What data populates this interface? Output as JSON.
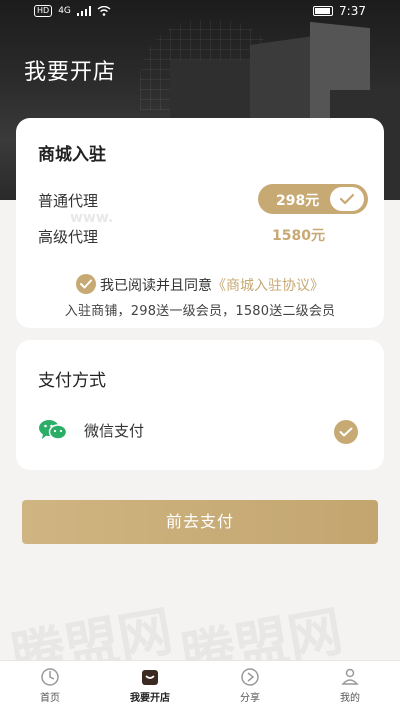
{
  "status_bar": {
    "hd": "HD",
    "signal": "4G",
    "time": "7:37"
  },
  "header": {
    "title": "我要开店"
  },
  "store_card": {
    "title": "商城入驻",
    "options": [
      {
        "label": "普通代理",
        "price": "298元",
        "selected": true
      },
      {
        "label": "高级代理",
        "price": "1580元",
        "selected": false
      }
    ],
    "agreement_prefix": "我已阅读并且同意",
    "agreement_link": "《商城入驻协议》",
    "note": "入驻商铺，298送一级会员，1580送二级会员"
  },
  "payment_card": {
    "title": "支付方式",
    "method_label": "微信支付",
    "method_icon": "wechat-icon",
    "selected": true
  },
  "pay_button": {
    "label": "前去支付"
  },
  "watermark": {
    "small": "www.",
    "large_left": "腾盟网",
    "large_right": "腾盟网"
  },
  "tabbar": {
    "items": [
      {
        "label": "首页",
        "icon": "home-icon"
      },
      {
        "label": "我要开店",
        "icon": "shop-icon",
        "active": true
      },
      {
        "label": "分享",
        "icon": "share-icon"
      },
      {
        "label": "我的",
        "icon": "profile-icon"
      }
    ]
  },
  "colors": {
    "accent": "#c7a974",
    "background": "#f4f3f1",
    "banner": "#2b2b2b",
    "wechat_green": "#2aae67"
  }
}
